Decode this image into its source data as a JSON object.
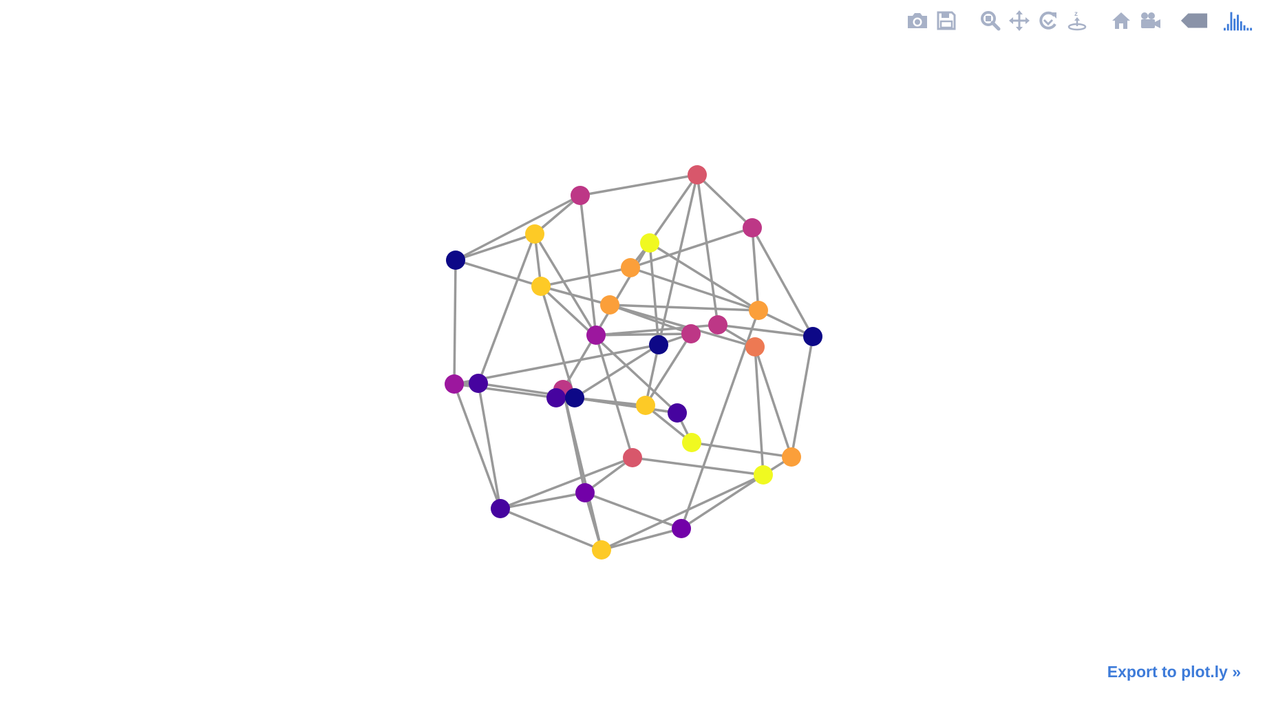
{
  "plot": {
    "type": "3d-network-scatter",
    "edge_color": "#999999",
    "colorscale": "Plasma",
    "node_colors": [
      "#0d0887",
      "#46039f",
      "#7201a8",
      "#9c179e",
      "#bd3786",
      "#d8576b",
      "#ed7953",
      "#fb9f3a",
      "#fdca26",
      "#f0f921"
    ]
  },
  "modebar": {
    "buttons": [
      {
        "id": "download-png",
        "icon": "camera-icon"
      },
      {
        "id": "save-to-cloud",
        "icon": "floppy-disk-icon"
      },
      {
        "id": "zoom",
        "icon": "zoom-icon"
      },
      {
        "id": "pan",
        "icon": "pan-icon"
      },
      {
        "id": "orbit-rotation",
        "icon": "orbit-rotate-icon"
      },
      {
        "id": "turntable-rotation",
        "icon": "turntable-rotate-icon"
      },
      {
        "id": "reset-camera-default",
        "icon": "home-icon"
      },
      {
        "id": "reset-camera-last-save",
        "icon": "camera-video-icon"
      },
      {
        "id": "toggle-hover",
        "icon": "tag-icon"
      },
      {
        "id": "plotly-logo",
        "icon": "plotly-bars-logo-icon"
      }
    ]
  },
  "footer": {
    "export_label": "Export to plot.ly »"
  }
}
